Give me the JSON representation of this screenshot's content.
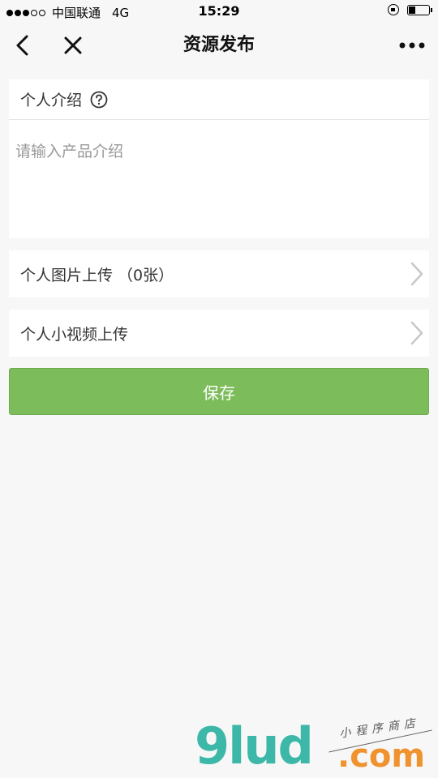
{
  "status_bar": {
    "carrier": "中国联通",
    "network": "4G",
    "time": "15:29",
    "signal_filled": 3,
    "signal_total": 5,
    "battery_level": 0.25
  },
  "nav": {
    "title": "资源发布",
    "back_icon": "chevron-left-icon",
    "close_icon": "close-icon",
    "more_icon": "more-dots-icon"
  },
  "intro": {
    "label": "个人介绍",
    "help_icon": "question-circle-icon",
    "placeholder": "请输入产品介绍",
    "value": ""
  },
  "rows": [
    {
      "label": "个人图片上传 （0张）",
      "icon": "chevron-right-icon"
    },
    {
      "label": "个人小视频上传",
      "icon": "chevron-right-icon"
    }
  ],
  "save_label": "保存",
  "colors": {
    "accent": "#7dbc5b",
    "background": "#f7f7f7"
  },
  "watermark": {
    "logo": "9lud",
    "domain": ".com",
    "tagline": "小程序商店"
  }
}
